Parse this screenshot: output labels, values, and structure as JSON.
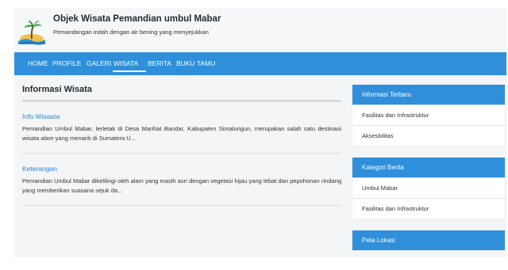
{
  "header": {
    "title": "Objek Wisata Pemandian umbul Mabar",
    "tagline": "Pemandangan indah dengan air bening yang menyejukkan",
    "logo_icon": "island-palm-logo"
  },
  "nav": {
    "items": [
      "HOME",
      "PROFILE",
      "GALERI",
      "WISATA",
      "BERITA",
      "BUKU TAMU"
    ],
    "active": "WISATA"
  },
  "main": {
    "title": "Informasi Wisata",
    "articles": [
      {
        "title": "Info Wisaata",
        "body": "Pemandian Umbul Mabar, terletak di Desa Marihat Bandar, Kabupaten Simalungun, merupakan salah satu destinasi wisata alam yang menarik di Sumatera U..."
      },
      {
        "title": "Keterangan",
        "body": "Pemandian Umbul Mabar dikelilingi oleh alam yang masih asri dengan vegetasi hijau yang lebat dan pepohonan rindang yang memberikan suasana sejuk da..."
      }
    ]
  },
  "sidebar": {
    "latest": {
      "heading": "Informasi Terbaru",
      "items": [
        "Fasilitas dan Infrastruktur",
        "Aksesbilitas"
      ]
    },
    "categories": {
      "heading": "Kategori Berita",
      "items": [
        "Umbul Mabar",
        "Fasilitas dan Infrastruktur"
      ]
    },
    "map": {
      "heading": "Peta Lokasi"
    }
  },
  "colors": {
    "primary": "#2f8fdb",
    "link": "#2d83d3",
    "background": "#f3f5f7"
  }
}
